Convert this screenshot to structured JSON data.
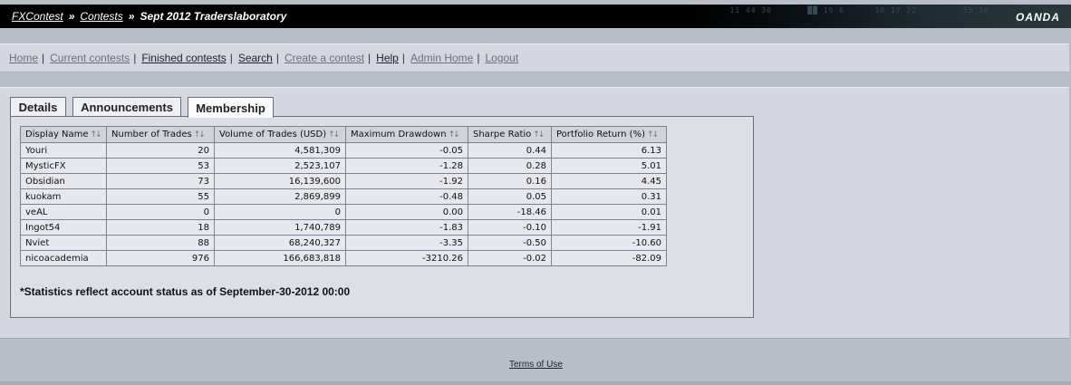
{
  "header": {
    "breadcrumbs": [
      {
        "label": "FXContest",
        "link": true
      },
      {
        "label": "Contests",
        "link": true
      },
      {
        "label": "Sept 2012 Traderslaboratory",
        "link": false
      }
    ],
    "brand": "OANDA"
  },
  "nav": {
    "items": [
      {
        "label": "Home",
        "muted": true
      },
      {
        "label": "Current contests",
        "muted": true
      },
      {
        "label": "Finished contests",
        "muted": false
      },
      {
        "label": "Search",
        "muted": false
      },
      {
        "label": "Create a contest",
        "muted": true
      },
      {
        "label": "Help",
        "muted": false
      },
      {
        "label": "Admin Home",
        "muted": true
      },
      {
        "label": "Logout",
        "muted": true
      }
    ]
  },
  "tabs": [
    {
      "label": "Details",
      "active": false
    },
    {
      "label": "Announcements",
      "active": false
    },
    {
      "label": "Membership",
      "active": true
    }
  ],
  "table": {
    "columns": [
      "Display Name",
      "Number of Trades",
      "Volume of Trades (USD)",
      "Maximum Drawdown",
      "Sharpe Ratio",
      "Portfolio Return (%)"
    ],
    "sort_icon": "sort-updown-icon",
    "rows": [
      [
        "Youri",
        "20",
        "4,581,309",
        "-0.05",
        "0.44",
        "6.13"
      ],
      [
        "MysticFX",
        "53",
        "2,523,107",
        "-1.28",
        "0.28",
        "5.01"
      ],
      [
        "Obsidian",
        "73",
        "16,139,600",
        "-1.92",
        "0.16",
        "4.45"
      ],
      [
        "kuokam",
        "55",
        "2,869,899",
        "-0.48",
        "0.05",
        "0.31"
      ],
      [
        "veAL",
        "0",
        "0",
        "0.00",
        "-18.46",
        "0.01"
      ],
      [
        "Ingot54",
        "18",
        "1,740,789",
        "-1.83",
        "-0.10",
        "-1.91"
      ],
      [
        "Nviet",
        "88",
        "68,240,327",
        "-3.35",
        "-0.50",
        "-10.60"
      ],
      [
        "nicoacademia",
        "976",
        "166,683,818",
        "-3210.26",
        "-0.02",
        "-82.09"
      ]
    ]
  },
  "note": "*Statistics reflect account status as of September-30-2012 00:00",
  "footer": {
    "terms": "Terms of Use"
  }
}
